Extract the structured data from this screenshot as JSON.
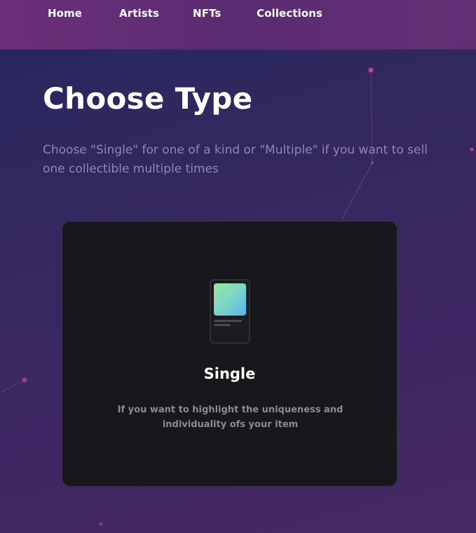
{
  "nav": {
    "items": [
      {
        "label": "Home"
      },
      {
        "label": "Artists"
      },
      {
        "label": "NFTs"
      },
      {
        "label": "Collections"
      }
    ]
  },
  "hero": {
    "title": "Choose Type",
    "subtitle": "Choose \"Single\" for one of a kind or \"Multiple\" if you want to sell one collectible multiple times"
  },
  "card": {
    "icon": "single-item-icon",
    "title": "Single",
    "description": "If you want to highlight the uniqueness and individuality ofs your item"
  },
  "colors": {
    "background": "#33285f",
    "navbar": "#5b2c72",
    "card": "#18181c",
    "accent_dot": "#c23f97",
    "text_muted": "#8e8aa8"
  }
}
